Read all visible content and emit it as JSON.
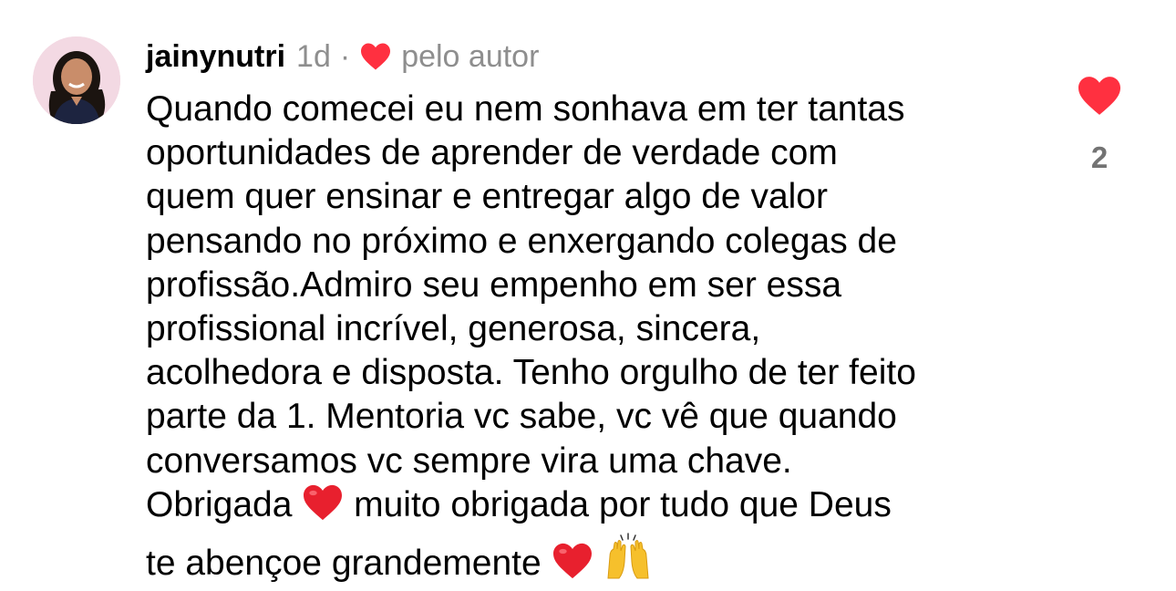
{
  "comment": {
    "username": "jainynutri",
    "time": "1d",
    "separator": "·",
    "author_like_label": "pelo autor",
    "like_count": "2",
    "colors": {
      "heart_red": "#ff3040",
      "meta_gray": "#8e8e8e",
      "count_gray": "#737373"
    },
    "icons": {
      "author_heart": "heart-icon",
      "like": "heart-icon-filled",
      "emoji_heart": "red-heart-emoji",
      "emoji_hands": "raising-hands-emoji"
    },
    "lines": [
      "Quando comecei eu nem sonhava em ter tantas",
      "oportunidades de aprender de verdade com",
      "quem quer ensinar e entregar algo de valor",
      "pensando no próximo e enxergando colegas de",
      "profissão.Admiro seu empenho em ser essa",
      "profissional incrível, generosa, sincera,",
      "acolhedora e disposta. Tenho orgulho de ter feito",
      "parte da 1. Mentoria vc sabe, vc vê que quando",
      "conversamos vc sempre vira uma chave."
    ],
    "line10_before": "Obrigada",
    "line10_after": "muito obrigada por tudo que Deus",
    "line11_text": "te abençoe grandemente"
  }
}
